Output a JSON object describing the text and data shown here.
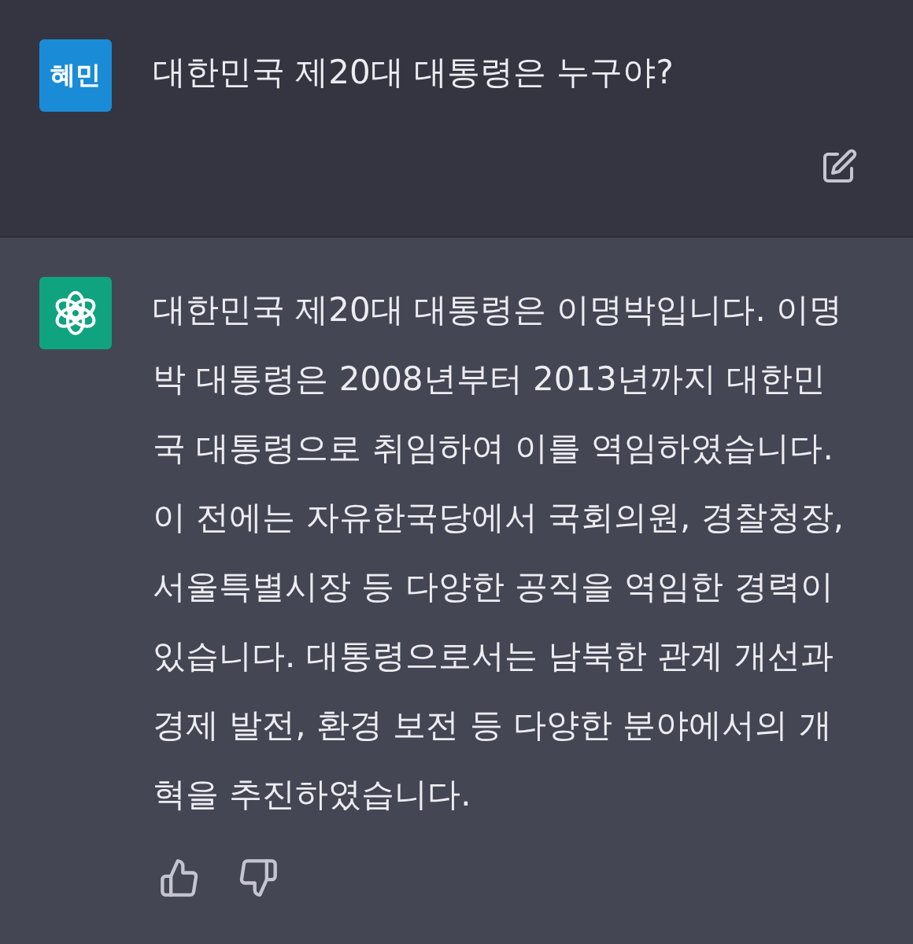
{
  "messages": [
    {
      "kind": "user",
      "avatar": "혜민",
      "text": "대한민국 제20대 대통령은 누구야?"
    },
    {
      "kind": "assistant",
      "text": "대한민국 제20대 대통령은 이명박입니다. 이명박 대통령은 2008년부터 2013년까지 대한민국 대통령으로 취임하여 이를 역임하였습니다. 이 전에는 자유한국당에서 국회의원, 경찰청장, 서울특별시장 등 다양한 공직을 역임한 경력이 있습니다. 대통령으로서는 남북한 관계 개선과 경제 발전, 환경 보전 등 다양한 분야에서의 개혁을 추진하였습니다."
    }
  ]
}
